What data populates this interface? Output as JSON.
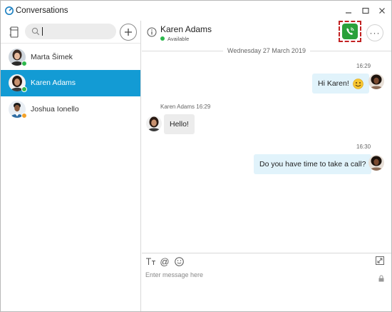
{
  "window": {
    "title": "Conversations",
    "logo_icon": "cisco-jabber-logo",
    "minimize_icon": "minimize-icon",
    "maximize_icon": "maximize-icon",
    "close_icon": "close-icon"
  },
  "sidebar": {
    "phonebook_icon": "phonebook-icon",
    "search": {
      "placeholder": "",
      "value": ""
    },
    "add_icon": "plus-icon",
    "contacts": [
      {
        "name": "Marta Šimek",
        "presence": "available",
        "presence_color": "#2db84d",
        "selected": false
      },
      {
        "name": "Karen Adams",
        "presence": "available",
        "presence_color": "#2db84d",
        "selected": true
      },
      {
        "name": "Joshua Ionello",
        "presence": "away",
        "presence_color": "#f2a22a",
        "selected": false
      }
    ]
  },
  "chat_header": {
    "contact_name": "Karen Adams",
    "status": "Available",
    "status_color": "#2db84d",
    "call_icon": "phone-call-icon",
    "more_label": "···"
  },
  "conversation": {
    "date_separator": "Wednesday 27 March 2019",
    "messages": [
      {
        "direction": "outgoing",
        "time": "16:29",
        "text": "Hi Karen!",
        "emoji": "smiley-emoji"
      },
      {
        "direction": "incoming",
        "sender_time": "Karen Adams 16:29",
        "text": "Hello!"
      },
      {
        "direction": "outgoing",
        "time": "16:30",
        "text": "Do you have time to take a call?"
      }
    ]
  },
  "composer": {
    "font_icon": "text-format-icon",
    "mention_label": "@",
    "emoji_icon": "smiley-icon",
    "placeholder": "Enter message here",
    "expand_icon": "expand-icon",
    "lock_icon": "lock-icon"
  },
  "colors": {
    "accent": "#139bd4",
    "call_green": "#2aa13b",
    "outgoing_bubble": "#e1f3fb",
    "incoming_bubble": "#ececec",
    "highlight_red": "#c22222"
  }
}
